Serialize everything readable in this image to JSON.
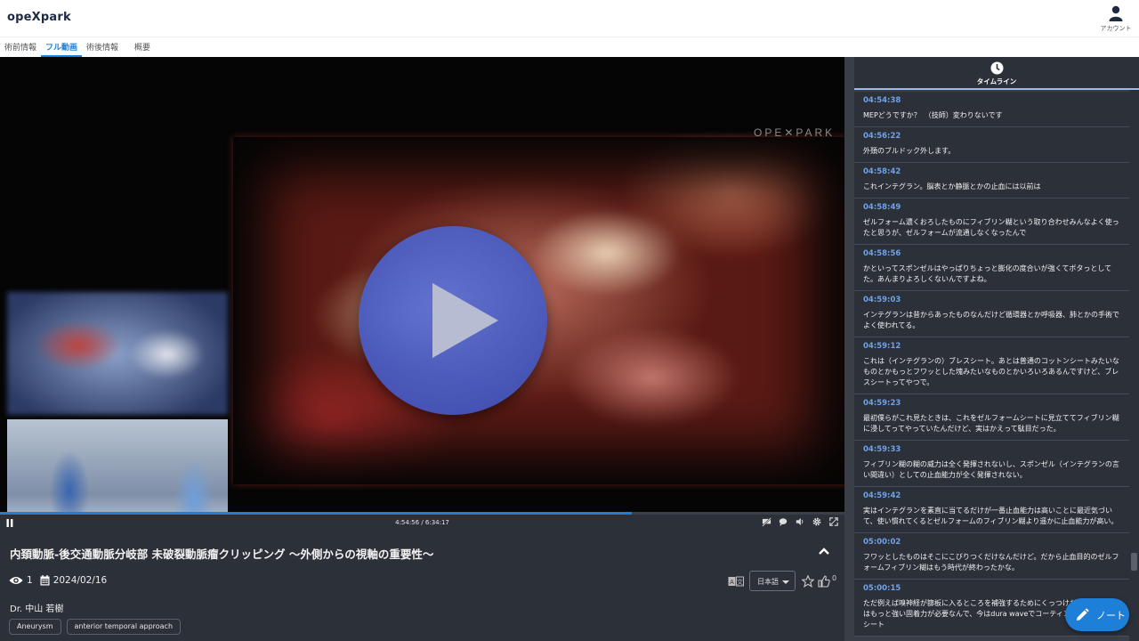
{
  "app": {
    "logo": "opeXpark"
  },
  "account": {
    "label": "アカウント",
    "icon": "user-icon"
  },
  "tabs": [
    {
      "label": "術前情報"
    },
    {
      "label": "フル動画"
    },
    {
      "label": "術後情報"
    },
    {
      "label": "概要"
    }
  ],
  "video": {
    "watermark": "OPE✕PARK",
    "time_display": "4:54:56 / 6:34:17",
    "progress": 0.748
  },
  "info": {
    "title": "内頚動脈-後交通動脈分岐部 未破裂動脈瘤クリッピング ～外側からの視軸の重要性～",
    "views": "1",
    "date": "2024/02/16",
    "language": "日本語",
    "likes": "0",
    "doctor": "Dr. 中山 若樹",
    "tags": [
      "Aneurysm",
      "anterior temporal approach"
    ]
  },
  "sidebar": {
    "label": "タイムライン",
    "items": [
      {
        "time": "04:54:38",
        "text": "MEPどうですか？　（技師）変わりないです"
      },
      {
        "time": "04:56:22",
        "text": "外頚のブルドック外します。"
      },
      {
        "time": "04:58:42",
        "text": "これインテグラン。脳表とか静脈とかの止血には以前は"
      },
      {
        "time": "04:58:49",
        "text": "ゼルフォーム濃くおろしたものにフィブリン糊という取り合わせみんなよく使ったと思うが、ゼルフォームが流通しなくなったんで"
      },
      {
        "time": "04:58:56",
        "text": "かといってスポンゼルはやっぱりちょっと膨化の度合いが強くてボタっとしてた。あんまりよろしくないんですよね。"
      },
      {
        "time": "04:59:03",
        "text": "インテグランは昔からあったものなんだけど循環器とか呼吸器、肺とかの手術でよく使われてる。"
      },
      {
        "time": "04:59:12",
        "text": "これは（インテグランの）ブレスシート。あとは普通のコットンシートみたいなものとかもっとフワッとした塊みたいなものとかいろいろあるんですけど、ブレスシートってやつで。"
      },
      {
        "time": "04:59:23",
        "text": "最初僕らがこれ見たときは、これをゼルフォームシートに見立ててフィブリン糊に浸してってやっていたんだけど、実はかえって駄目だった。"
      },
      {
        "time": "04:59:33",
        "text": "フィブリン糊の糊の威力は全く発揮されないし、スポンゼル（インテグランの言い間違い）としての止血能力が全く発揮されない。"
      },
      {
        "time": "04:59:42",
        "text": "実はインテグランを素直に当てるだけが一番止血能力は高いことに最近気づいて、使い慣れてくるとゼルフォームのフィブリン糊より遥かに止血能力が高い。"
      },
      {
        "time": "05:00:02",
        "text": "フワッとしたものはそこにこびりつくだけなんだけど。だから止血目的のゼルフォームフィブリン糊はもう時代が終わったかな。"
      },
      {
        "time": "05:00:15",
        "text": "ただ例えば嗅神経が篩板に入るところを補強するためにくっつけたりするところはもっと強い固着力が必要なんで、今はdura waveでコーティングしてシール膜シート"
      }
    ]
  },
  "note_button": {
    "label": "ノート"
  }
}
